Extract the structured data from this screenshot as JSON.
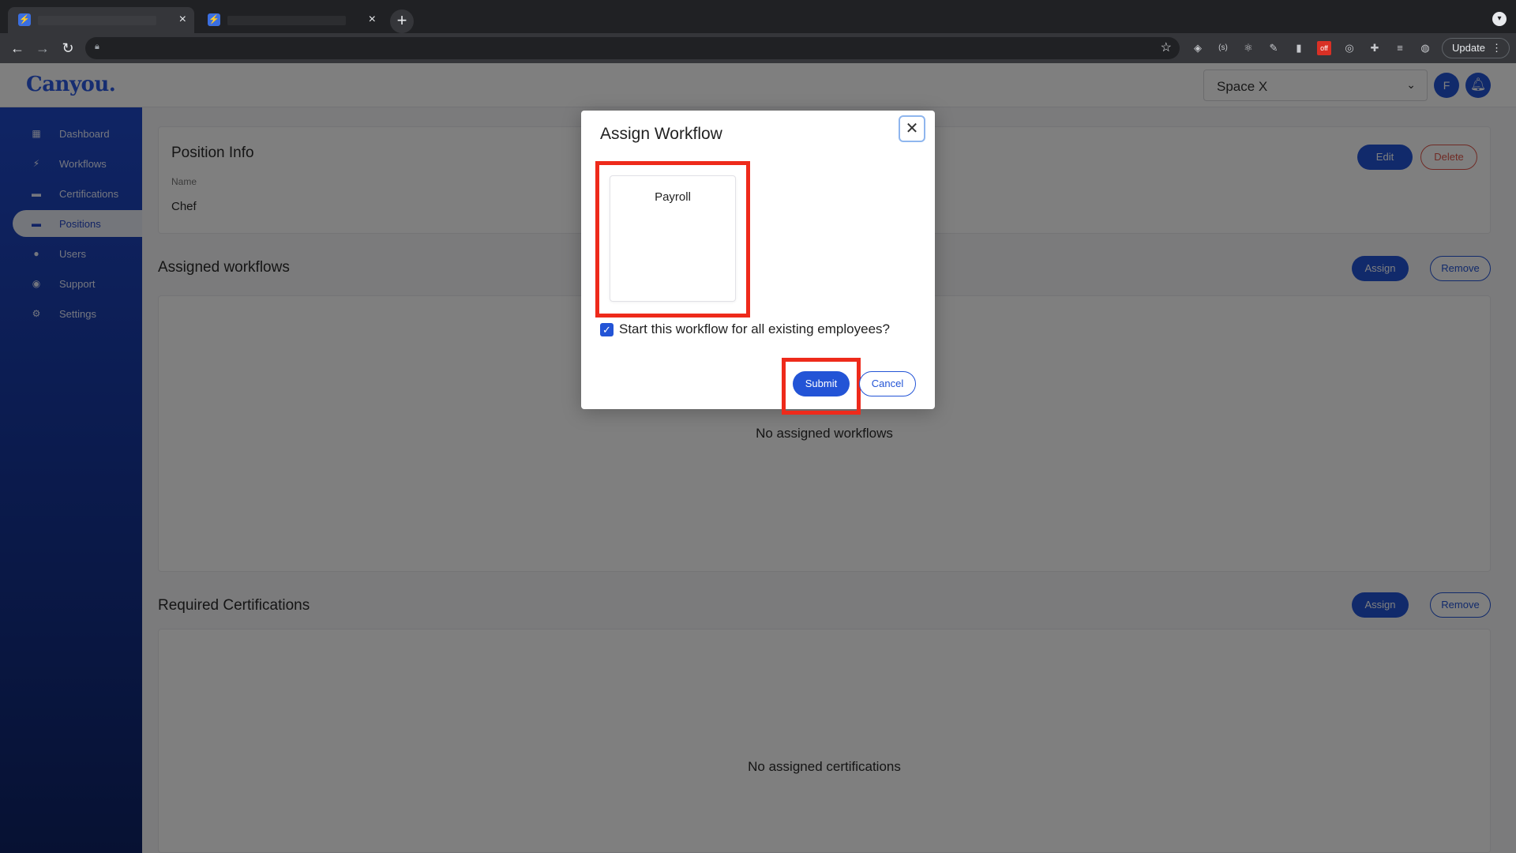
{
  "browser": {
    "tab_close": "×",
    "new_tab": "+",
    "update_label": "Update",
    "menu_dots": "⋮",
    "back": "←",
    "forward": "→",
    "reload": "↻",
    "bookmark_star": "☆",
    "extension_icons": [
      "shield-extension-icon",
      "code-extension-icon",
      "react-extension-icon",
      "pen-extension-icon",
      "bookmark-extension-icon",
      "off-extension-icon",
      "target-extension-icon",
      "puzzle-extension-icon",
      "playlist-extension-icon",
      "profile-extension-icon"
    ]
  },
  "app": {
    "logo": "Canyou.",
    "company": "Space X",
    "avatar_initial": "F",
    "accent": "#2354d6"
  },
  "sidebar": {
    "items": [
      {
        "label": "Dashboard",
        "icon": "dashboard-icon",
        "active": false
      },
      {
        "label": "Workflows",
        "icon": "bolt-icon",
        "active": false
      },
      {
        "label": "Certifications",
        "icon": "briefcase-icon",
        "active": false
      },
      {
        "label": "Positions",
        "icon": "briefcase-icon",
        "active": true
      },
      {
        "label": "Users",
        "icon": "user-icon",
        "active": false
      },
      {
        "label": "Support",
        "icon": "chat-icon",
        "active": false
      },
      {
        "label": "Settings",
        "icon": "gear-icon",
        "active": false
      }
    ]
  },
  "position_info": {
    "title": "Position Info",
    "name_label": "Name",
    "name_value": "Chef",
    "edit_label": "Edit",
    "delete_label": "Delete"
  },
  "assigned_workflows": {
    "title": "Assigned workflows",
    "assign_label": "Assign",
    "remove_label": "Remove",
    "empty_text": "No assigned workflows"
  },
  "required_certifications": {
    "title": "Required Certifications",
    "assign_label": "Assign",
    "remove_label": "Remove",
    "empty_text": "No assigned certifications"
  },
  "modal": {
    "title": "Assign Workflow",
    "close_symbol": "✕",
    "workflow_option": "Payroll",
    "checkbox_checked": true,
    "checkbox_label": "Start this workflow for all existing employees?",
    "submit_label": "Submit",
    "cancel_label": "Cancel",
    "highlight_color": "#ee2a1b"
  }
}
